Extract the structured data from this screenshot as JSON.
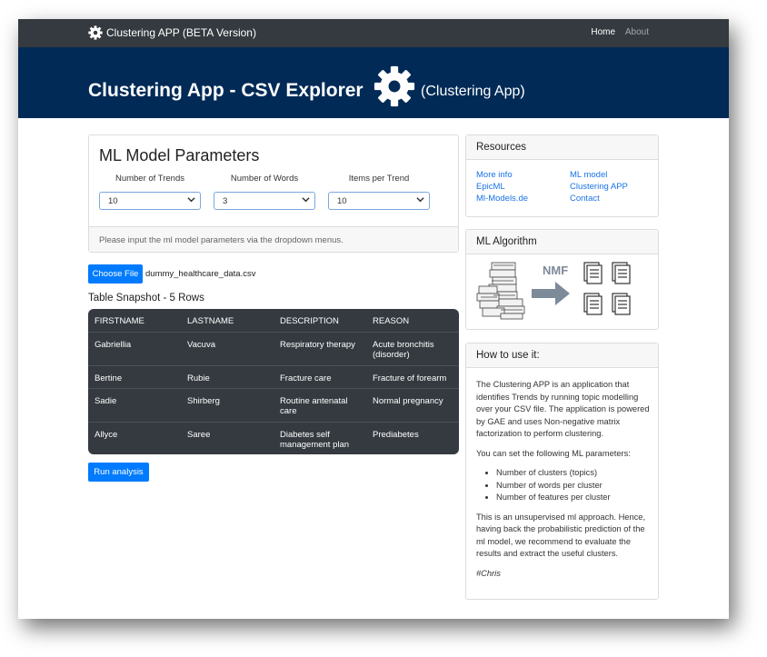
{
  "navbar": {
    "brand": "Clustering APP (BETA Version)",
    "links": [
      "Home",
      "About"
    ]
  },
  "hero": {
    "title": "Clustering App - CSV Explorer",
    "subtitle": "(Clustering App)"
  },
  "params": {
    "title": "ML Model Parameters",
    "fields": [
      {
        "label": "Number of Trends",
        "value": "10"
      },
      {
        "label": "Number of Words",
        "value": "3"
      },
      {
        "label": "Items per Trend",
        "value": "10"
      }
    ],
    "footer": "Please input the ml model parameters via the dropdown menus."
  },
  "upload": {
    "button": "Choose File",
    "filename": "dummy_healthcare_data.csv"
  },
  "table": {
    "heading": "Table Snapshot - 5 Rows",
    "columns": [
      "FIRSTNAME",
      "LASTNAME",
      "DESCRIPTION",
      "REASON"
    ],
    "rows": [
      [
        "Gabriellia",
        "Vacuva",
        "Respiratory therapy",
        "Acute bronchitis (disorder)"
      ],
      [
        "Bertine",
        "Rubie",
        "Fracture care",
        "Fracture of forearm"
      ],
      [
        "Sadie",
        "Shirberg",
        "Routine antenatal care",
        "Normal pregnancy"
      ],
      [
        "Allyce",
        "Saree",
        "Diabetes self management plan",
        "Prediabetes"
      ]
    ]
  },
  "run_button": "Run analysis",
  "resources": {
    "title": "Resources",
    "links": [
      "More info",
      "EpicML",
      "Ml-Models.de",
      "ML model",
      "Clustering APP",
      "Contact"
    ]
  },
  "algorithm": {
    "title": "ML Algorithm",
    "label": "NMF"
  },
  "howto": {
    "title": "How to use it:",
    "intro": "The Clustering APP is an application that identifies Trends by running topic modelling over your CSV file. The application is powered by GAE and uses Non-negative matrix factorization to perform clustering.",
    "set_text": "You can set the following ML parameters:",
    "items": [
      "Number of clusters (topics)",
      "Number of words per cluster",
      "Number of features per cluster"
    ],
    "outro": "This is an unsupervised ml approach. Hence, having back the probabilistic prediction of the ml model, we recommend to evaluate the results and extract the useful clusters.",
    "signature": "#Chris"
  },
  "colors": {
    "navbar": "#343a40",
    "hero": "#012a56",
    "primary": "#007bff",
    "link": "#1a73e8"
  }
}
